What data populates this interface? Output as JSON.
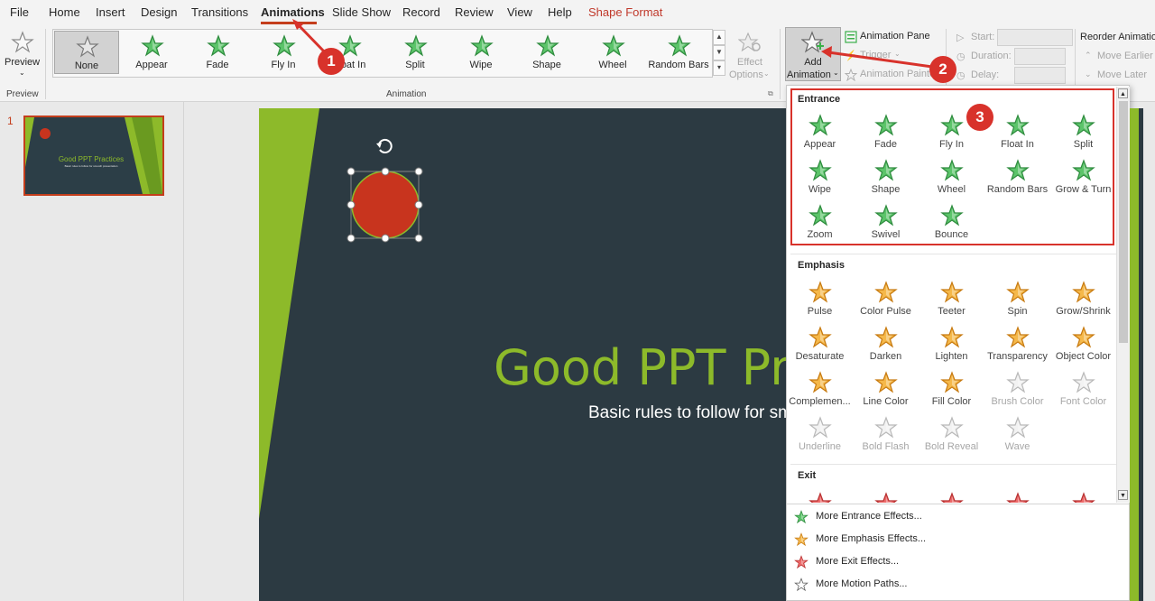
{
  "menu": {
    "tabs": [
      "File",
      "Home",
      "Insert",
      "Design",
      "Transitions",
      "Animations",
      "Slide Show",
      "Record",
      "Review",
      "View",
      "Help",
      "Shape Format"
    ],
    "active_tab": "Animations"
  },
  "ribbon": {
    "preview_label": "Preview",
    "preview_group": "Preview",
    "animation_group": "Animation",
    "gallery": [
      "None",
      "Appear",
      "Fade",
      "Fly In",
      "Float In",
      "Split",
      "Wipe",
      "Shape",
      "Wheel",
      "Random Bars"
    ],
    "effect_options_line1": "Effect",
    "effect_options_line2": "Options",
    "add_animation_line1": "Add",
    "add_animation_line2": "Animation",
    "animation_pane": "Animation Pane",
    "trigger": "Trigger",
    "animation_painter": "Animation Painter",
    "start": "Start:",
    "duration": "Duration:",
    "delay": "Delay:",
    "reorder": "Reorder Animation",
    "move_earlier": "Move Earlier",
    "move_later": "Move Later"
  },
  "slides": {
    "number": "1",
    "thumb_title": "Good PPT Practices",
    "thumb_subtitle": "Basic rules to follow for smooth presentation"
  },
  "slide": {
    "title": "Good PPT Pra",
    "subtitle": "Basic rules to follow for sm"
  },
  "dropdown": {
    "entrance_title": "Entrance",
    "entrance": [
      "Appear",
      "Fade",
      "Fly In",
      "Float In",
      "Split",
      "Wipe",
      "Shape",
      "Wheel",
      "Random Bars",
      "Grow & Turn",
      "Zoom",
      "Swivel",
      "Bounce"
    ],
    "emphasis_title": "Emphasis",
    "emphasis": [
      "Pulse",
      "Color Pulse",
      "Teeter",
      "Spin",
      "Grow/Shrink",
      "Desaturate",
      "Darken",
      "Lighten",
      "Transparency",
      "Object Color",
      "Complemen...",
      "Line Color",
      "Fill Color",
      "Brush Color",
      "Font Color",
      "Underline",
      "Bold Flash",
      "Bold Reveal",
      "Wave"
    ],
    "emphasis_disabled": [
      "Brush Color",
      "Font Color",
      "Underline",
      "Bold Flash",
      "Bold Reveal",
      "Wave"
    ],
    "exit_title": "Exit",
    "more": [
      "More Entrance Effects...",
      "More Emphasis Effects...",
      "More Exit Effects...",
      "More Motion Paths..."
    ]
  },
  "callouts": [
    "1",
    "2",
    "3"
  ],
  "colors": {
    "accent": "#c43e1c",
    "callout": "#d8322b",
    "entrance_green": "#3bb04a",
    "emphasis_gold": "#f0a030",
    "exit_red": "#e04848",
    "slide_bg": "#2c3a42",
    "slide_title": "#8dba2a"
  }
}
